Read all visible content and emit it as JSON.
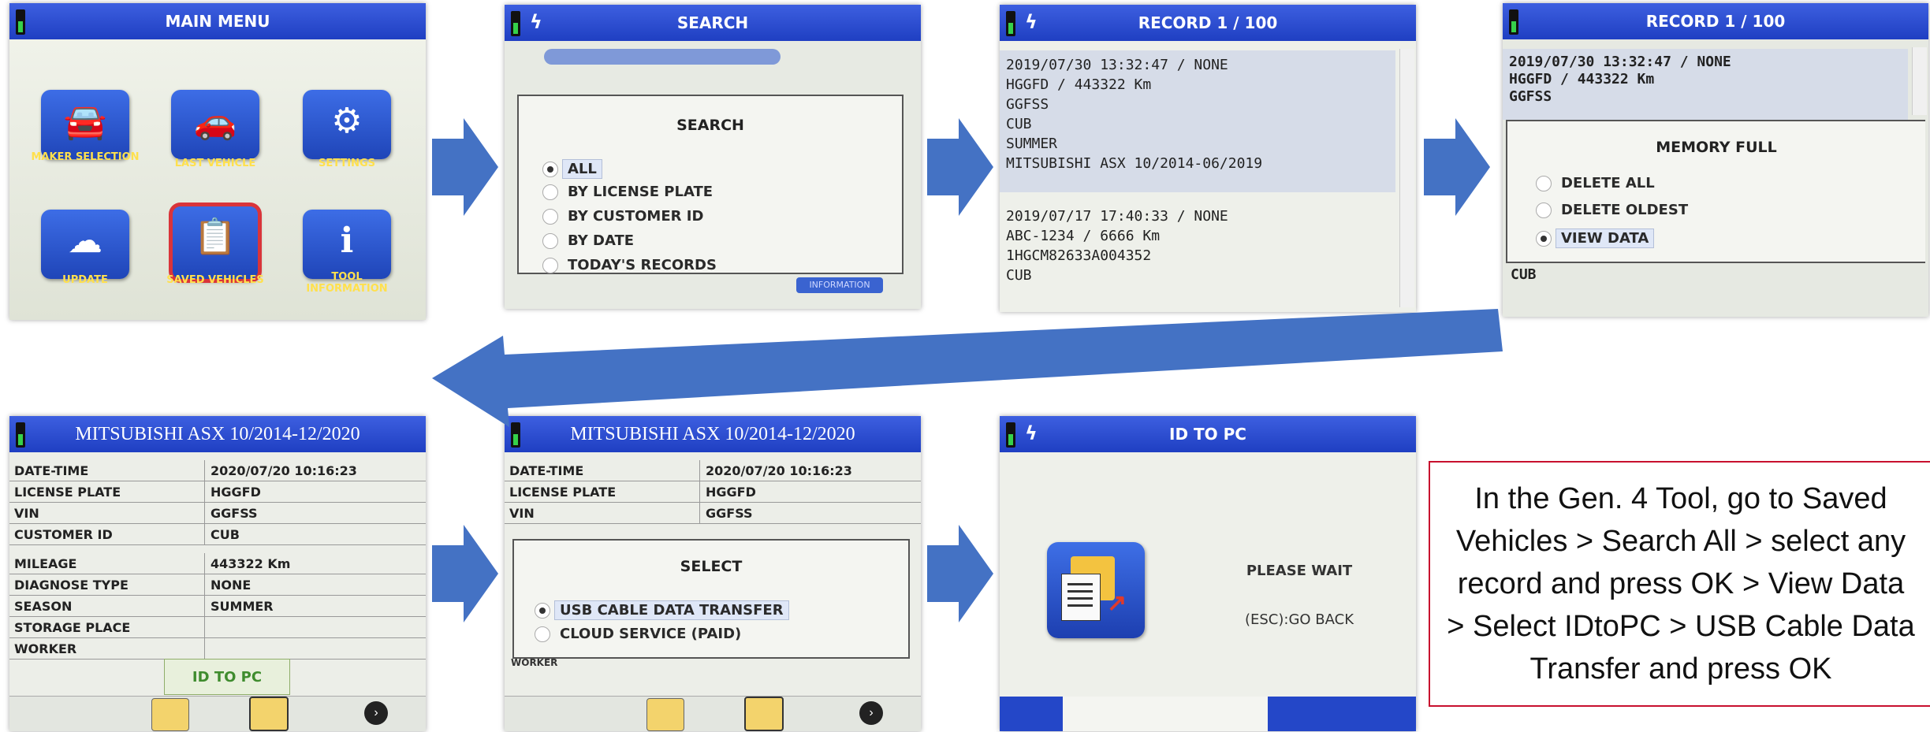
{
  "colors": {
    "title_bar": "#2447c8",
    "arrow": "#4472c4",
    "note_border": "#c8102e",
    "highlight": "#dfe7f7"
  },
  "screen1": {
    "title": "MAIN MENU",
    "icons": [
      {
        "label": "MAKER SELECTION",
        "icon": "car-icon"
      },
      {
        "label": "LAST VEHICLE",
        "icon": "car-return-icon"
      },
      {
        "label": "SETTINGS",
        "icon": "gear-icon"
      },
      {
        "label": "UPDATE",
        "icon": "cloud-icon"
      },
      {
        "label": "SAVED VEHICLES",
        "icon": "saved-vehicles-icon"
      },
      {
        "label": "TOOL INFORMATION",
        "icon": "info-icon"
      }
    ]
  },
  "screen2": {
    "title": "SEARCH",
    "dialog_title": "SEARCH",
    "options": [
      "ALL",
      "BY LICENSE PLATE",
      "BY CUSTOMER ID",
      "BY DATE",
      "TODAY'S RECORDS"
    ],
    "footer_fragment": "INFORMATION"
  },
  "screen3": {
    "title": "RECORD 1 / 100",
    "records": [
      [
        "2019/07/30 13:32:47 / NONE",
        "HGGFD / 443322 Km",
        "GGFSS",
        "CUB",
        "SUMMER",
        "MITSUBISHI ASX 10/2014-06/2019"
      ],
      [
        "2019/07/17 17:40:33 / NONE",
        "ABC-1234 / 6666 Km",
        "1HGCM82633A004352",
        "CUB"
      ]
    ]
  },
  "screen4": {
    "title": "RECORD 1 / 100",
    "record_lines": [
      "2019/07/30 13:32:47 / NONE",
      "HGGFD / 443322 Km",
      "GGFSS"
    ],
    "dialog_title": "MEMORY FULL",
    "options": [
      "DELETE ALL",
      "DELETE OLDEST",
      "VIEW DATA"
    ],
    "footer_line": "CUB"
  },
  "screen5": {
    "title": "MITSUBISHI ASX 10/2014-12/2020",
    "rows": [
      {
        "k": "DATE-TIME",
        "v": "2020/07/20 10:16:23"
      },
      {
        "k": "LICENSE PLATE",
        "v": "HGGFD"
      },
      {
        "k": "VIN",
        "v": "GGFSS"
      },
      {
        "k": "CUSTOMER ID",
        "v": "CUB"
      },
      {
        "k": "MILEAGE",
        "v": "443322 Km"
      },
      {
        "k": "DIAGNOSE TYPE",
        "v": "NONE"
      },
      {
        "k": "SEASON",
        "v": "SUMMER"
      },
      {
        "k": "STORAGE PLACE",
        "v": ""
      },
      {
        "k": "WORKER",
        "v": ""
      }
    ],
    "popup": "ID TO PC"
  },
  "screen6": {
    "title": "MITSUBISHI ASX 10/2014-12/2020",
    "rows": [
      {
        "k": "DATE-TIME",
        "v": "2020/07/20 10:16:23"
      },
      {
        "k": "LICENSE PLATE",
        "v": "HGGFD"
      },
      {
        "k": "VIN",
        "v": "GGFSS"
      }
    ],
    "dialog_title": "SELECT",
    "options": [
      "USB CABLE DATA TRANSFER",
      "CLOUD SERVICE (PAID)"
    ],
    "footer_fragment": "WORKER"
  },
  "screen7": {
    "title": "ID TO PC",
    "status": "PLEASE WAIT",
    "back": "(ESC):GO BACK"
  },
  "instructions": "In the Gen. 4 Tool, go to Saved Vehicles > Search All > select any record and press OK > View Data > Select IDtoPC > USB Cable Data Transfer and press OK"
}
